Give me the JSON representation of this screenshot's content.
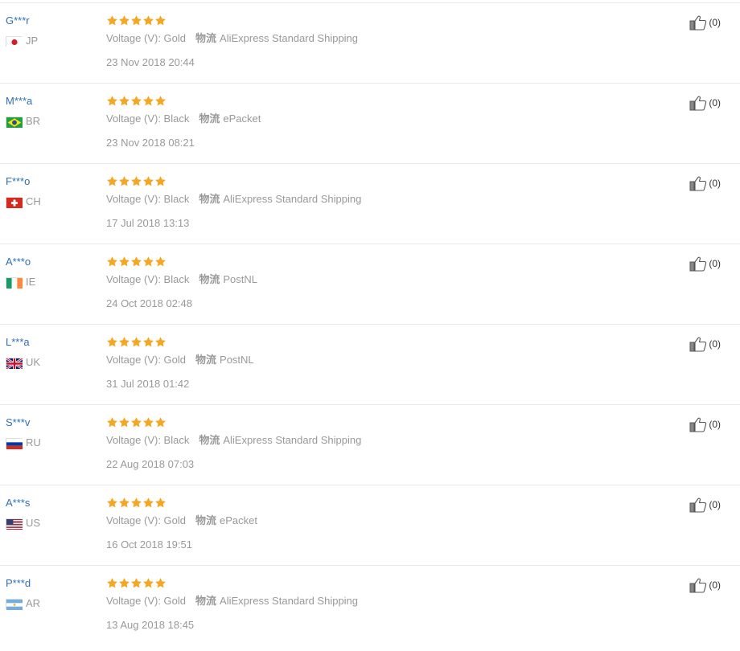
{
  "colors": {
    "star": "#f5a623",
    "username": "#2f6fb5",
    "meta": "#999999"
  },
  "reviews": [
    {
      "user": "G***r",
      "country": "JP",
      "flag": "jp",
      "rating": 5,
      "attr_label": "Voltage (V): ",
      "attr_value": "Gold",
      "ship_label": "物流",
      "ship_value": "AliExpress Standard Shipping",
      "date": "23 Nov 2018 20:44",
      "helpful": "(0)"
    },
    {
      "user": "M***a",
      "country": "BR",
      "flag": "br",
      "rating": 5,
      "attr_label": "Voltage (V): ",
      "attr_value": "Black",
      "ship_label": "物流",
      "ship_value": "ePacket",
      "date": "23 Nov 2018 08:21",
      "helpful": "(0)"
    },
    {
      "user": "F***o",
      "country": "CH",
      "flag": "ch",
      "rating": 5,
      "attr_label": "Voltage (V): ",
      "attr_value": "Black",
      "ship_label": "物流",
      "ship_value": "AliExpress Standard Shipping",
      "date": "17 Jul 2018 13:13",
      "helpful": "(0)"
    },
    {
      "user": "A***o",
      "country": "IE",
      "flag": "ie",
      "rating": 5,
      "attr_label": "Voltage (V): ",
      "attr_value": "Black",
      "ship_label": "物流",
      "ship_value": "PostNL",
      "date": "24 Oct 2018 02:48",
      "helpful": "(0)"
    },
    {
      "user": "L***a",
      "country": "UK",
      "flag": "uk",
      "rating": 5,
      "attr_label": "Voltage (V): ",
      "attr_value": "Gold",
      "ship_label": "物流",
      "ship_value": "PostNL",
      "date": "31 Jul 2018 01:42",
      "helpful": "(0)"
    },
    {
      "user": "S***v",
      "country": "RU",
      "flag": "ru",
      "rating": 5,
      "attr_label": "Voltage (V): ",
      "attr_value": "Black",
      "ship_label": "物流",
      "ship_value": "AliExpress Standard Shipping",
      "date": "22 Aug 2018 07:03",
      "helpful": "(0)"
    },
    {
      "user": "A***s",
      "country": "US",
      "flag": "us",
      "rating": 5,
      "attr_label": "Voltage (V): ",
      "attr_value": "Gold",
      "ship_label": "物流",
      "ship_value": "ePacket",
      "date": "16 Oct 2018 19:51",
      "helpful": "(0)"
    },
    {
      "user": "P***d",
      "country": "AR",
      "flag": "ar",
      "rating": 5,
      "attr_label": "Voltage (V): ",
      "attr_value": "Gold",
      "ship_label": "物流",
      "ship_value": "AliExpress Standard Shipping",
      "date": "13 Aug 2018 18:45",
      "helpful": "(0)"
    }
  ]
}
